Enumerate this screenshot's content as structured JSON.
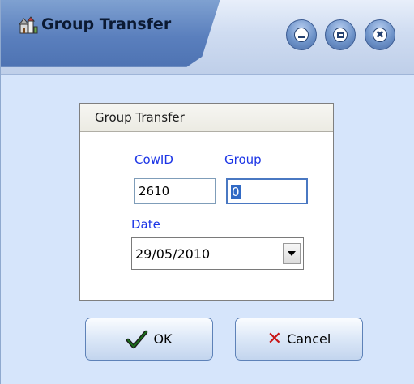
{
  "window": {
    "title": "Group Transfer",
    "controls": {
      "minimize": "minimize-button",
      "maximize": "maximize-button",
      "close": "close-button"
    }
  },
  "groupbox": {
    "title": "Group Transfer",
    "cowid_label": "CowID",
    "cowid_value": "2610",
    "group_label": "Group",
    "group_value": "0",
    "date_label": "Date",
    "date_value": "29/05/2010"
  },
  "buttons": {
    "ok_label": "OK",
    "cancel_label": "Cancel"
  },
  "icons": {
    "app": "farm-building-icon",
    "ok": "checkmark-icon",
    "cancel": "x-icon",
    "dropdown": "chevron-down-icon"
  },
  "colors": {
    "titlebar": "#5a7fbd",
    "window_bg": "#d6e5fb",
    "label_blue": "#1c35e6",
    "cancel_red": "#c81414",
    "ok_green": "#1b6d1b"
  }
}
